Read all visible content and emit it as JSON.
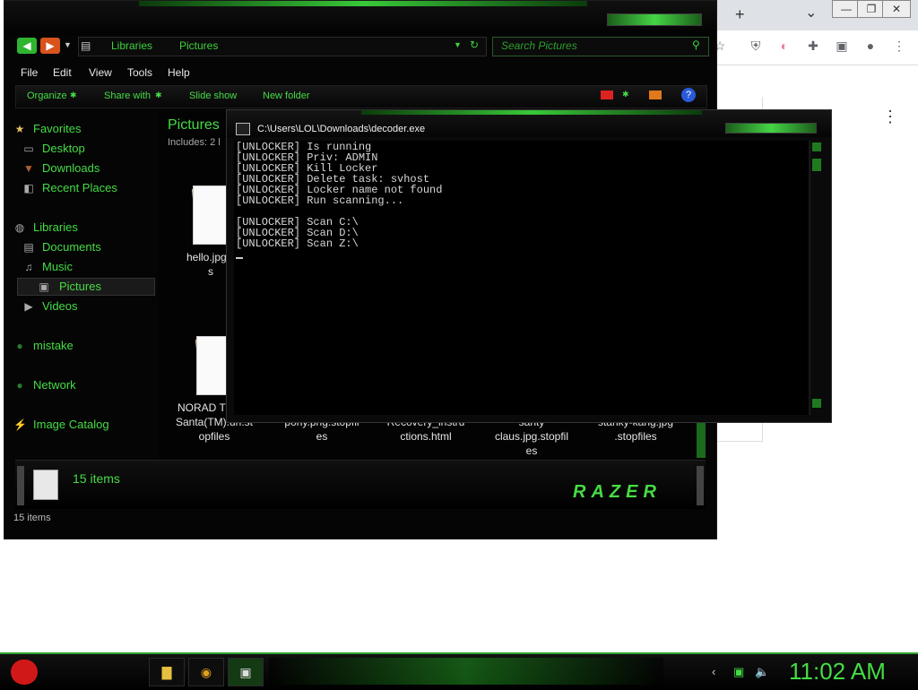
{
  "chrome": {
    "new_tab_icon": "+",
    "dropdown_icon": "⌄",
    "menu_icon": "⋮",
    "window_controls": [
      "—",
      "❐",
      "✕"
    ],
    "toolbar_icons": [
      "star-icon",
      "ublock-icon",
      "extension-icon",
      "puzzle-icon",
      "sidepanel-icon",
      "profile-icon",
      "menu-icon"
    ]
  },
  "explorer": {
    "address": {
      "crumbs": [
        "Libraries",
        "Pictures"
      ],
      "search_placeholder": "Search Pictures"
    },
    "menu": [
      "File",
      "Edit",
      "View",
      "Tools",
      "Help"
    ],
    "commands": [
      "Organize",
      "Share with",
      "Slide show",
      "New folder"
    ],
    "sidebar": {
      "favorites_label": "Favorites",
      "favorites": [
        "Desktop",
        "Downloads",
        "Recent Places"
      ],
      "libraries_label": "Libraries",
      "libraries": [
        "Documents",
        "Music",
        "Pictures",
        "Videos"
      ],
      "mistake": "mistake",
      "network": "Network",
      "image_catalog": "Image Catalog"
    },
    "content": {
      "title": "Pictures",
      "includes": "Includes:  2 l",
      "files": [
        "hello.jpg.s\ns",
        "NORAD Tracks\nSanta(TM).url.st\nopfiles",
        "pony.png.stopfil\nes",
        "Recovery_instru\nctions.html",
        "santy\nclaus.jpg.stopfil\nes",
        "stanky-kang.jpg\n.stopfiles"
      ]
    },
    "details_count": "15 items",
    "brand": "RAZER",
    "status": "15 items"
  },
  "console": {
    "title": "C:\\Users\\LOL\\Downloads\\decoder.exe",
    "lines": [
      "[UNLOCKER] Is running",
      "[UNLOCKER] Priv: ADMIN",
      "[UNLOCKER] Kill Locker",
      "[UNLOCKER] Delete task: svhost",
      "[UNLOCKER] Locker name not found",
      "[UNLOCKER] Run scanning...",
      "",
      "[UNLOCKER] Scan C:\\",
      "[UNLOCKER] Scan D:\\",
      "[UNLOCKER] Scan Z:\\"
    ]
  },
  "taskbar": {
    "clock": "11:02 AM",
    "apps": [
      "explorer-icon",
      "chrome-icon",
      "console-icon"
    ]
  }
}
